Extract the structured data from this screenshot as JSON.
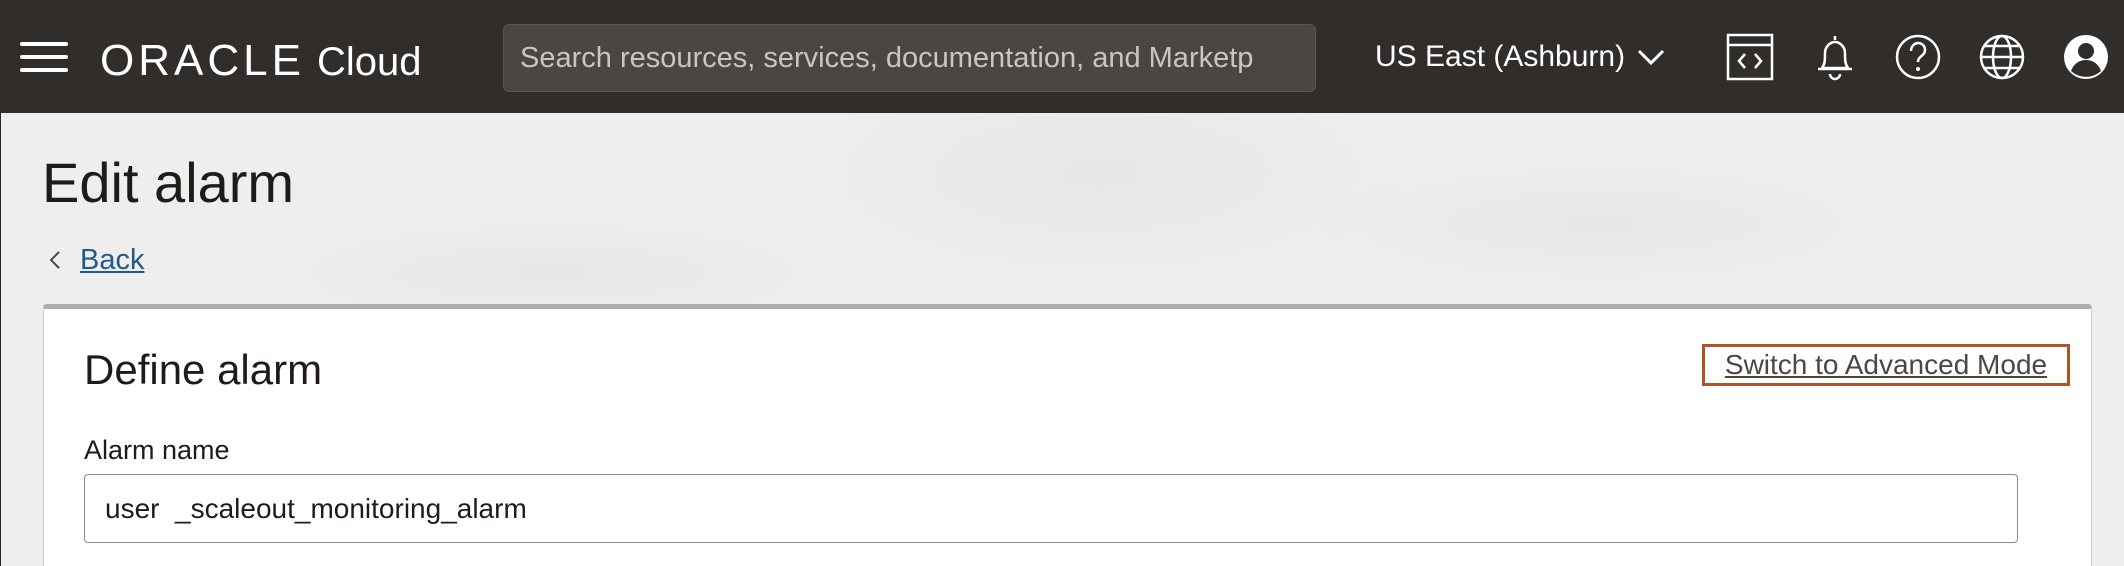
{
  "header": {
    "brand_name": "ORACLE",
    "brand_product": "Cloud",
    "search_placeholder": "Search resources, services, documentation, and Marketp",
    "region": "US East (Ashburn)",
    "icons": [
      "menu-icon",
      "code-editor-icon",
      "bell-icon",
      "help-icon",
      "globe-icon",
      "user-avatar-icon"
    ],
    "colors": {
      "bar": "#312d2a",
      "accent_border": "#b05426",
      "link": "#1e5a8c"
    }
  },
  "page": {
    "title": "Edit alarm",
    "back_label": "Back"
  },
  "card": {
    "title": "Define alarm",
    "advanced_mode_link": "Switch to Advanced Mode",
    "alarm_name_label": "Alarm name",
    "alarm_name_value": "user  _scaleout_monitoring_alarm"
  }
}
